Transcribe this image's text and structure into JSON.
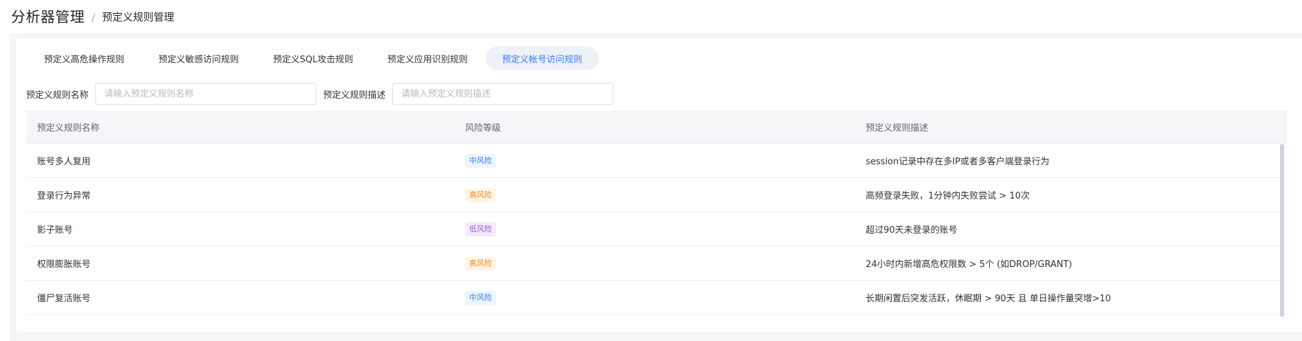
{
  "header": {
    "breadcrumb_main": "分析器管理",
    "breadcrumb_sep": "/",
    "breadcrumb_sub": "预定义规则管理"
  },
  "tabs": [
    {
      "label": "预定义高危操作规则",
      "active": false
    },
    {
      "label": "预定义敏感访问规则",
      "active": false
    },
    {
      "label": "预定义SQL攻击规则",
      "active": false
    },
    {
      "label": "预定义应用识别规则",
      "active": false
    },
    {
      "label": "预定义帐号访问规则",
      "active": true
    }
  ],
  "filters": {
    "name_label": "预定义规则名称",
    "name_placeholder": "请输入预定义规则名称",
    "name_value": "",
    "desc_label": "预定义规则描述",
    "desc_placeholder": "请输入预定义规则描述",
    "desc_value": ""
  },
  "table": {
    "columns": [
      "预定义规则名称",
      "风险等级",
      "预定义规则描述"
    ],
    "rows": [
      {
        "name": "账号多人复用",
        "risk": "中风险",
        "risk_level": "medium",
        "desc": "session记录中存在多IP或者多客户端登录行为"
      },
      {
        "name": "登录行为异常",
        "risk": "高风险",
        "risk_level": "high",
        "desc": "高频登录失败，1分钟内失败尝试 > 10次"
      },
      {
        "name": "影子账号",
        "risk": "低风险",
        "risk_level": "low",
        "desc": "超过90天未登录的账号"
      },
      {
        "name": "权限膨胀账号",
        "risk": "高风险",
        "risk_level": "high",
        "desc": "24小时内新增高危权限数 > 5个 (如DROP/GRANT)"
      },
      {
        "name": "僵尸复活账号",
        "risk": "中风险",
        "risk_level": "medium",
        "desc": "长期闲置后突发活跃，休眠期 > 90天 且 单日操作量突增>10"
      }
    ]
  },
  "colors": {
    "accent": "#3a7bf7",
    "risk_medium_text": "#3a7bf7",
    "risk_medium_bg": "#ecf4ff",
    "risk_high_text": "#f08a24",
    "risk_high_bg": "#fff4e6",
    "risk_low_text": "#9b59d0",
    "risk_low_bg": "#f4eafb"
  }
}
